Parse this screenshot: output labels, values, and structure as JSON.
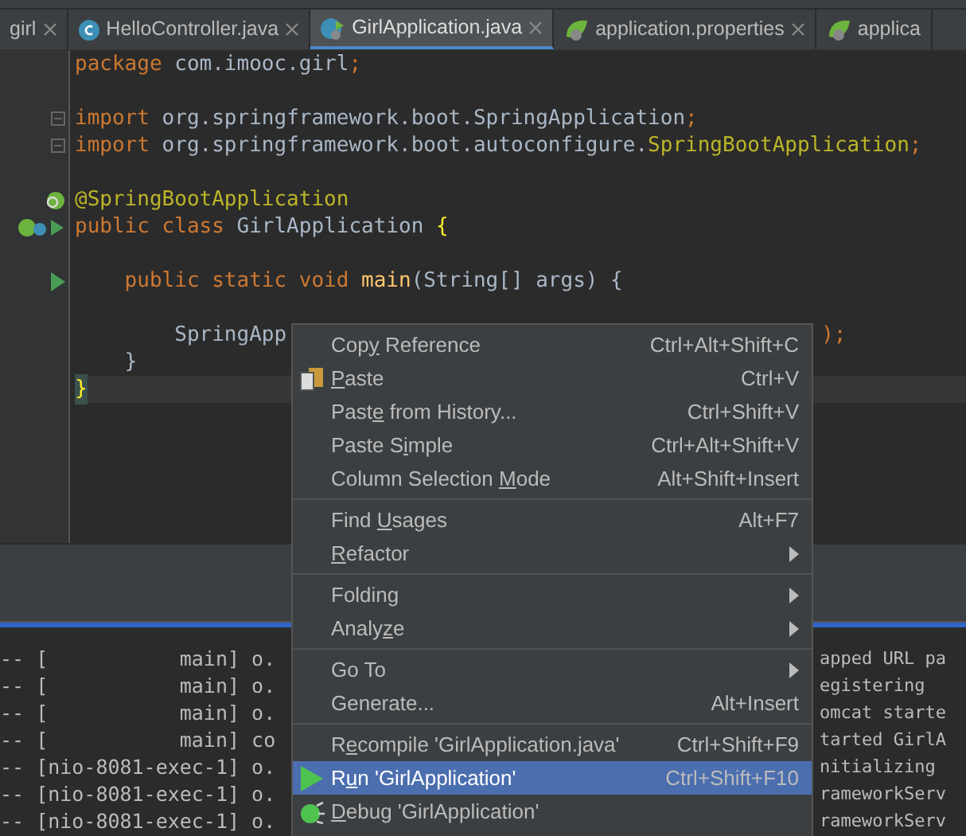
{
  "tabs": [
    {
      "label": "girl",
      "selected": false
    },
    {
      "label": "HelloController.java",
      "selected": false
    },
    {
      "label": "GirlApplication.java",
      "selected": true
    },
    {
      "label": "application.properties",
      "selected": false
    },
    {
      "label": "applica",
      "selected": false
    }
  ],
  "editor": {
    "lines": [
      {
        "kind": "code",
        "segments": [
          {
            "kind": "keyword",
            "text": "package "
          },
          {
            "kind": "plain",
            "text": "com.imooc.girl"
          },
          {
            "kind": "keyword",
            "text": ";"
          }
        ]
      },
      {
        "kind": "blank"
      },
      {
        "kind": "code",
        "segments": [
          {
            "kind": "keyword",
            "text": "import "
          },
          {
            "kind": "plain",
            "text": "org.springframework.boot.SpringApplication"
          },
          {
            "kind": "keyword",
            "text": ";"
          }
        ]
      },
      {
        "kind": "code",
        "segments": [
          {
            "kind": "keyword",
            "text": "import "
          },
          {
            "kind": "plain",
            "text": "org.springframework.boot.autoconfigure."
          },
          {
            "kind": "annotation",
            "text": "SpringBootApplication"
          },
          {
            "kind": "keyword",
            "text": ";"
          }
        ]
      },
      {
        "kind": "blank"
      },
      {
        "kind": "code",
        "segments": [
          {
            "kind": "annotation",
            "text": "@SpringBootApplication"
          }
        ]
      },
      {
        "kind": "code",
        "segments": [
          {
            "kind": "keyword",
            "text": "public class "
          },
          {
            "kind": "plain",
            "text": "GirlApplication "
          },
          {
            "kind": "brace",
            "text": "{"
          }
        ]
      },
      {
        "kind": "blank"
      },
      {
        "kind": "code",
        "segments": [
          {
            "kind": "keyword",
            "text": "    public static void "
          },
          {
            "kind": "method",
            "text": "main"
          },
          {
            "kind": "plain",
            "text": "(String[] args) {"
          }
        ]
      },
      {
        "kind": "blank"
      },
      {
        "kind": "split",
        "segments": [
          {
            "kind": "plain",
            "text": "        SpringApp"
          },
          {
            "kind": "keyword",
            "text": ");"
          }
        ]
      },
      {
        "kind": "code",
        "segments": [
          {
            "kind": "plain",
            "text": "    }"
          }
        ]
      },
      {
        "kind": "code",
        "current": true,
        "segments": [
          {
            "kind": "brace",
            "text": "}"
          }
        ]
      }
    ]
  },
  "console": {
    "rows": [
      {
        "left": "-- [           main] o.",
        "right": "apped URL pa"
      },
      {
        "left": "-- [           main] o.",
        "right": "egistering"
      },
      {
        "left": "-- [           main] o.",
        "right": "omcat starte"
      },
      {
        "left": "-- [           main] co",
        "right": "tarted GirlA"
      },
      {
        "left": "-- [nio-8081-exec-1] o.",
        "right": "nitializing"
      },
      {
        "left": "-- [nio-8081-exec-1] o.",
        "right": "rameworkServ"
      },
      {
        "left": "-- [nio-8081-exec-1] o.",
        "right": "rameworkServ"
      }
    ]
  },
  "context_menu": {
    "groups": [
      [
        {
          "before": "Cop",
          "key": "y",
          "after": " Reference",
          "shortcut": "Ctrl+Alt+Shift+C",
          "submenu": false,
          "selected": false
        },
        {
          "key": "P",
          "after": "aste",
          "shortcut": "Ctrl+V",
          "submenu": false,
          "selected": false
        },
        {
          "before": "Past",
          "key": "e",
          "after": " from History...",
          "shortcut": "Ctrl+Shift+V",
          "submenu": false,
          "selected": false
        },
        {
          "before": "Paste S",
          "key": "i",
          "after": "mple",
          "shortcut": "Ctrl+Alt+Shift+V",
          "submenu": false,
          "selected": false
        },
        {
          "before": "Column Selection ",
          "key": "M",
          "after": "ode",
          "shortcut": "Alt+Shift+Insert",
          "submenu": false,
          "selected": false
        }
      ],
      [
        {
          "before": "Find ",
          "key": "U",
          "after": "sages",
          "shortcut": "Alt+F7",
          "submenu": false,
          "selected": false
        },
        {
          "key": "R",
          "after": "efactor",
          "submenu": true,
          "selected": false
        }
      ],
      [
        {
          "before": "Folding",
          "submenu": true,
          "selected": false
        },
        {
          "before": "Analy",
          "key": "z",
          "after": "e",
          "submenu": true,
          "selected": false
        }
      ],
      [
        {
          "before": "Go To",
          "submenu": true,
          "selected": false
        },
        {
          "before": "Generate...",
          "shortcut": "Alt+Insert",
          "submenu": false,
          "selected": false
        }
      ],
      [
        {
          "before": "R",
          "key": "e",
          "after": "compile 'GirlApplication.java'",
          "shortcut": "Ctrl+Shift+F9",
          "submenu": false,
          "selected": false
        },
        {
          "before": "R",
          "key": "u",
          "after": "n 'GirlApplication'",
          "shortcut": "Ctrl+Shift+F10",
          "submenu": false,
          "selected": true
        },
        {
          "key": "D",
          "after": "ebug 'GirlApplication'",
          "submenu": false,
          "selected": false
        }
      ]
    ]
  }
}
